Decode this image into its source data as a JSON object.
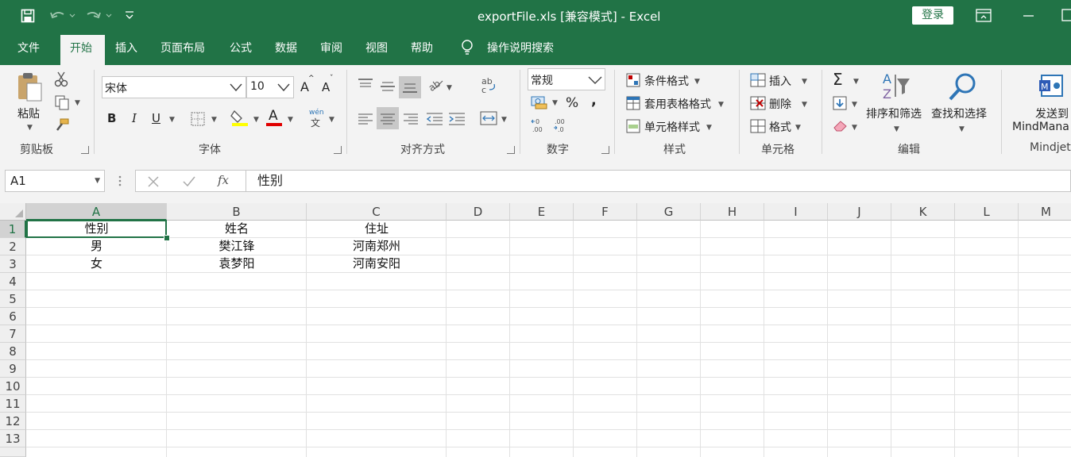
{
  "titlebar": {
    "title": "exportFile.xls  [兼容模式]  -  Excel",
    "login": "登录"
  },
  "menu": {
    "tabs": [
      "文件",
      "开始",
      "插入",
      "页面布局",
      "公式",
      "数据",
      "审阅",
      "视图",
      "帮助"
    ],
    "tell_me": "操作说明搜索"
  },
  "ribbon": {
    "clipboard": {
      "paste": "粘贴",
      "label": "剪贴板"
    },
    "font": {
      "name": "宋体",
      "size": "10",
      "grow": "A",
      "shrink": "A",
      "bold": "B",
      "italic": "I",
      "underline": "U",
      "font_color": "A",
      "phonetic": "wén",
      "label": "字体"
    },
    "alignment": {
      "label": "对齐方式"
    },
    "number": {
      "format": "常规",
      "percent": "%",
      "comma": ",",
      "label": "数字"
    },
    "styles": {
      "conditional": "条件格式",
      "table": "套用表格格式",
      "cell_styles": "单元格样式",
      "label": "样式"
    },
    "cells": {
      "insert": "插入",
      "delete": "删除",
      "format": "格式",
      "label": "单元格"
    },
    "editing": {
      "sort": "排序和筛选",
      "find": "查找和选择",
      "label": "编辑"
    },
    "mindjet": {
      "send1": "发送到",
      "send2": "MindMana",
      "label": "Mindjet"
    }
  },
  "formula_bar": {
    "name_box": "A1",
    "fx": "fx",
    "value": "性别"
  },
  "grid": {
    "columns": [
      "A",
      "B",
      "C",
      "D",
      "E",
      "F",
      "G",
      "H",
      "I",
      "J",
      "K",
      "L",
      "M"
    ],
    "rows": [
      "1",
      "2",
      "3",
      "4",
      "5",
      "6",
      "7",
      "8",
      "9",
      "10",
      "11",
      "12",
      "13"
    ],
    "cells": [
      [
        "性别",
        "姓名",
        "住址"
      ],
      [
        "男",
        "樊江锋",
        "河南郑州"
      ],
      [
        "女",
        "袁梦阳",
        "河南安阳"
      ]
    ]
  },
  "colors": {
    "accent": "#217346",
    "selection": "#217346"
  }
}
